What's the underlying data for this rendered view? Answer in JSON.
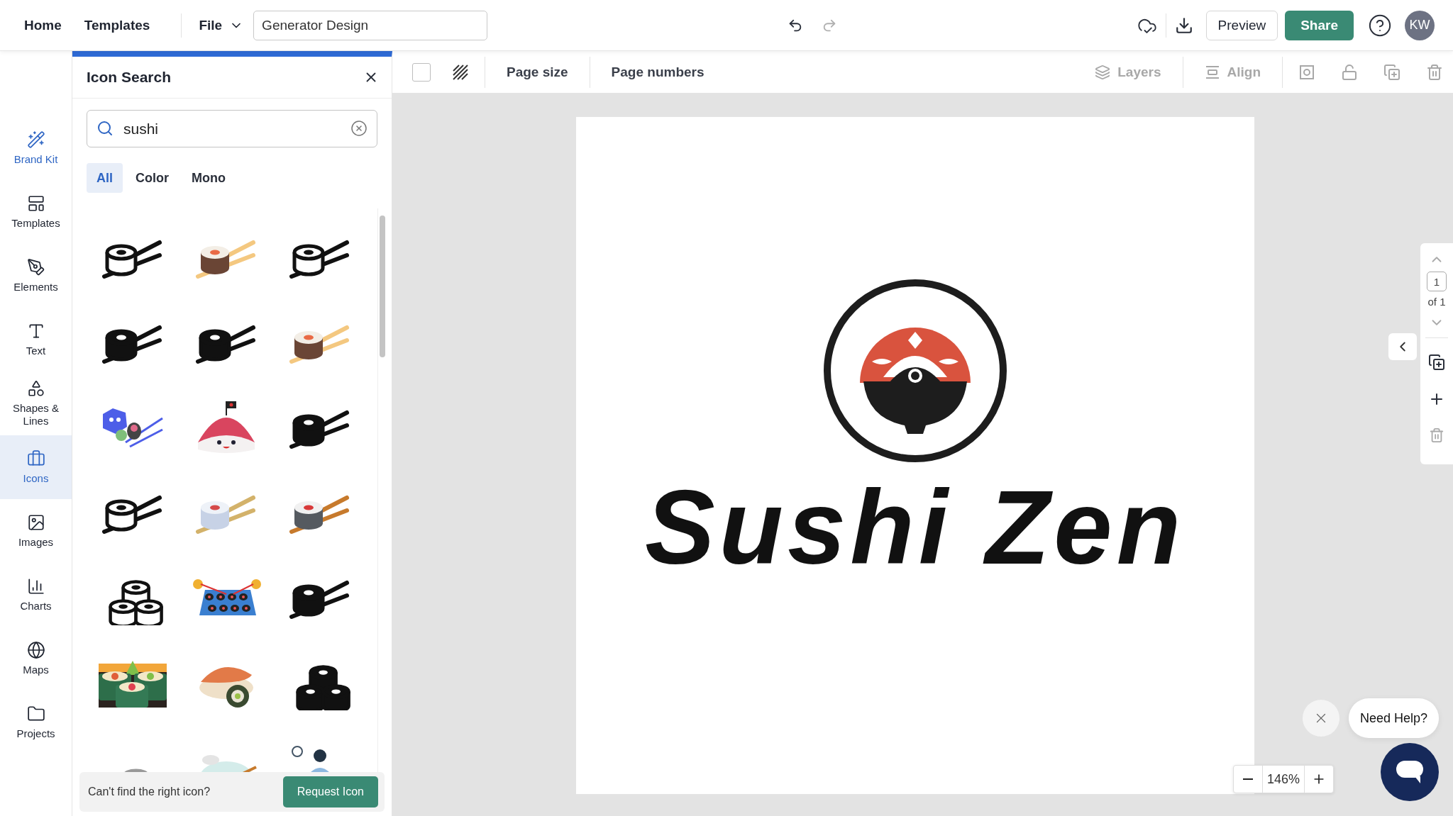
{
  "nav": {
    "links": [
      "Home",
      "Templates"
    ],
    "file_menu": "File",
    "document_title": "Generator Design",
    "preview": "Preview",
    "share": "Share",
    "avatar": "KW"
  },
  "sidebar": {
    "items": [
      {
        "label": "Brand Kit",
        "kind": "brand",
        "selected": false
      },
      {
        "label": "Templates",
        "kind": "templates",
        "selected": false
      },
      {
        "label": "Elements",
        "kind": "elements",
        "selected": false
      },
      {
        "label": "Text",
        "kind": "text",
        "selected": false
      },
      {
        "label": "Shapes & Lines",
        "kind": "shapes",
        "selected": false
      },
      {
        "label": "Icons",
        "kind": "icons",
        "selected": true
      },
      {
        "label": "Images",
        "kind": "images",
        "selected": false
      },
      {
        "label": "Charts",
        "kind": "charts",
        "selected": false
      },
      {
        "label": "Maps",
        "kind": "maps",
        "selected": false
      },
      {
        "label": "Projects",
        "kind": "projects",
        "selected": false
      }
    ]
  },
  "panel": {
    "title": "Icon Search",
    "search": {
      "value": "sushi"
    },
    "filters": [
      {
        "label": "All",
        "selected": true
      },
      {
        "label": "Color",
        "selected": false
      },
      {
        "label": "Mono",
        "selected": false
      }
    ],
    "results": [
      {
        "kind": "outline"
      },
      {
        "kind": "color"
      },
      {
        "kind": "outline"
      },
      {
        "kind": "solid"
      },
      {
        "kind": "solid"
      },
      {
        "kind": "color"
      },
      {
        "kind": "sticker"
      },
      {
        "kind": "character"
      },
      {
        "kind": "solid"
      },
      {
        "kind": "outline"
      },
      {
        "kind": "pale"
      },
      {
        "kind": "dark"
      },
      {
        "kind": "stack-outline"
      },
      {
        "kind": "tray"
      },
      {
        "kind": "solid"
      },
      {
        "kind": "platter"
      },
      {
        "kind": "nigiri"
      },
      {
        "kind": "stack-solid"
      },
      {
        "kind": "stack-grey"
      },
      {
        "kind": "cloud"
      },
      {
        "kind": "person"
      }
    ],
    "footer": {
      "text": "Can't find the right icon?",
      "button": "Request Icon"
    }
  },
  "toolbar": {
    "page_size": "Page size",
    "page_numbers": "Page numbers",
    "layers": "Layers",
    "align": "Align"
  },
  "canvas": {
    "logo_text": "Sushi Zen",
    "zoom": "146%"
  },
  "page_nav": {
    "current": "1",
    "total": "of 1"
  },
  "help": {
    "label": "Need Help?"
  }
}
